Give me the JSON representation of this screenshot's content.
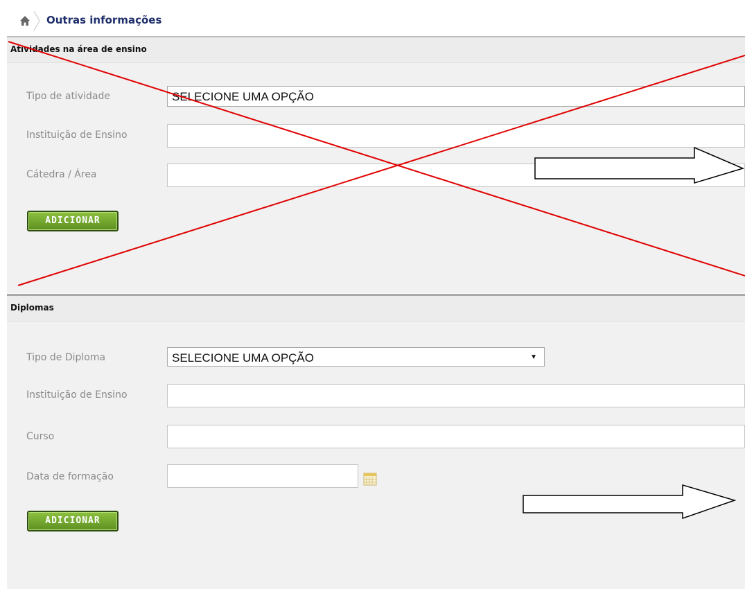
{
  "breadcrumb": {
    "title": "Outras informações",
    "icon": "home-icon"
  },
  "sections": [
    {
      "title": "Atividades na área de ensino",
      "fields": [
        {
          "label": "Tipo de atividade",
          "value": "SELECIONE UMA OPÇÃO"
        },
        {
          "label": "Instituição de Ensino",
          "value": ""
        },
        {
          "label": "Cátedra / Área",
          "value": ""
        }
      ],
      "button_label": "ADICIONAR"
    },
    {
      "title": "Diplomas",
      "fields": [
        {
          "label": "Tipo de Diploma",
          "value": "SELECIONE UMA OPÇÃO"
        },
        {
          "label": "Instituição de Ensino",
          "value": ""
        },
        {
          "label": "Curso",
          "value": ""
        },
        {
          "label": "Data de formação",
          "value": "",
          "icon": "calendar-icon"
        }
      ],
      "button_label": "ADICIONAR"
    }
  ],
  "annotations": {
    "cross_color": "#e00000",
    "arrow_color": "#000000"
  }
}
